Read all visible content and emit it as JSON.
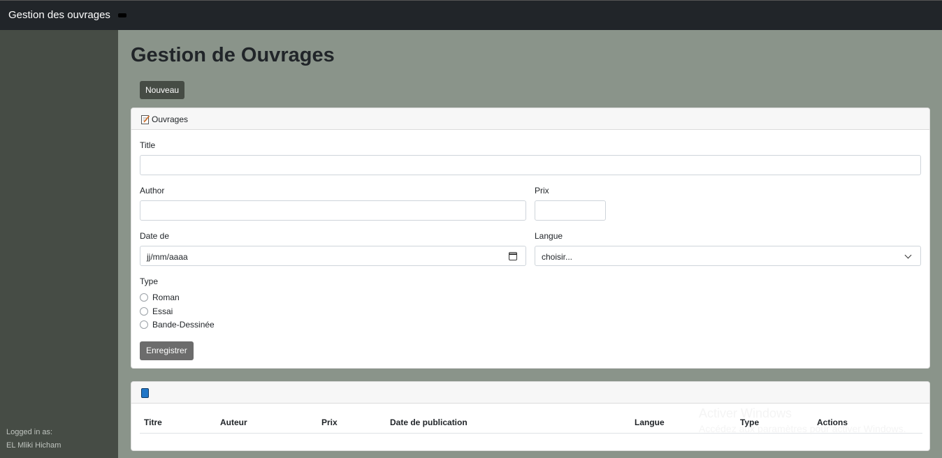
{
  "navbar": {
    "brand": "Gestion des ouvrages"
  },
  "sidebar": {
    "logged_in_label": "Logged in as:",
    "user_name": "EL Mliki Hicham"
  },
  "main": {
    "page_title": "Gestion de Ouvrages",
    "new_button": "Nouveau",
    "form_card": {
      "header_icon": "memo-icon",
      "header_title": "Ouvrages",
      "title_label": "Title",
      "title_value": "",
      "author_label": "Author",
      "author_value": "",
      "prix_label": "Prix",
      "prix_value": "",
      "date_label": "Date de",
      "date_placeholder": "jj/mm/aaaa",
      "langue_label": "Langue",
      "langue_selected": "choisir...",
      "type_label": "Type",
      "type_options": [
        "Roman",
        "Essai",
        "Bande-Dessinée"
      ],
      "save_button": "Enregistrer"
    },
    "table_card": {
      "header_icon": "book-icon",
      "columns": [
        "Titre",
        "Auteur",
        "Prix",
        "Date de publication",
        "Langue",
        "Type",
        "Actions"
      ],
      "rows": []
    }
  },
  "watermark": {
    "line1": "Activer Windows",
    "line2": "Accédez aux paramètres pour activer Windows."
  }
}
